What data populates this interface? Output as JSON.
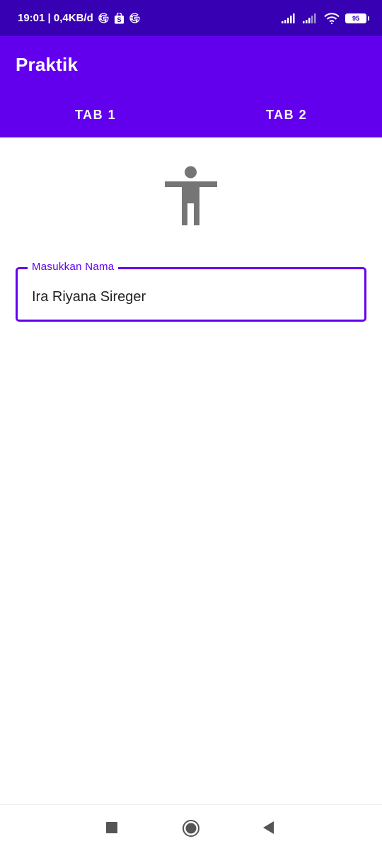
{
  "status_bar": {
    "time_info": "19:01 | 0,4KB/d",
    "battery": "95",
    "notification_icons": [
      "google-icon",
      "shopping-bag-icon",
      "google-icon"
    ],
    "system_icons": [
      "signal-icon",
      "signal-icon",
      "wifi-icon",
      "battery-icon"
    ]
  },
  "app_bar": {
    "title": "Praktik",
    "background": "#6200ee"
  },
  "tabs": [
    {
      "label": "TAB 1",
      "selected": true
    },
    {
      "label": "TAB 2",
      "selected": false
    }
  ],
  "content": {
    "icon": "accessibility-person-icon",
    "name_field": {
      "label": "Masukkan Nama",
      "value": "Ira Riyana Sireger"
    }
  },
  "nav_bar": {
    "icons": [
      "recents-square-icon",
      "home-circle-icon",
      "back-triangle-icon"
    ]
  },
  "colors": {
    "status_bar": "#3700b3",
    "primary": "#6200ee",
    "icon_gray": "#757575"
  }
}
